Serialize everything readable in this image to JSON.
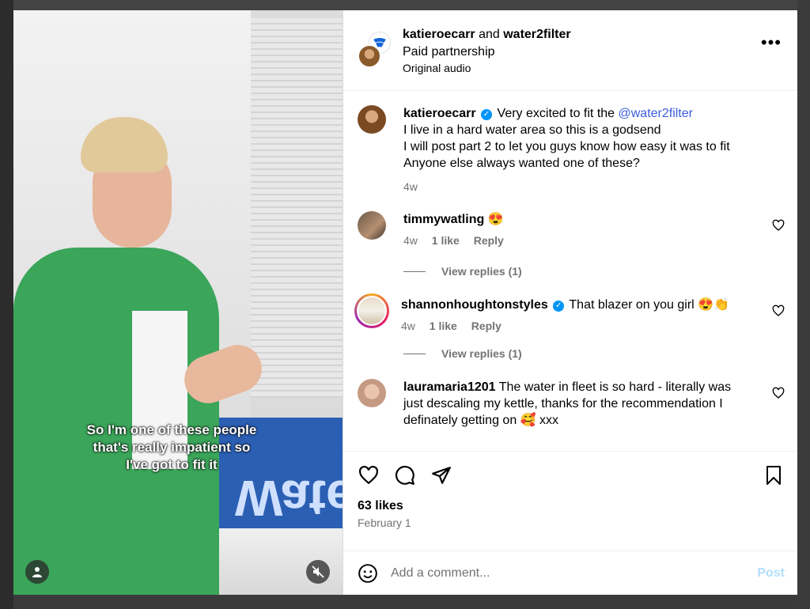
{
  "header": {
    "author": "katieroecarr",
    "conjunction": "and",
    "collaborator": "water2filter",
    "subtitle": "Paid partnership",
    "audio": "Original audio",
    "more_label": "•••"
  },
  "media": {
    "caption_lines": [
      "So I'm one of these people",
      "that's really impatient so",
      "I've got to fit it"
    ],
    "box_text": "Water"
  },
  "comments": [
    {
      "user": "katieroecarr",
      "verified": true,
      "text_before": "Very excited to fit the ",
      "mention": "@water2filter",
      "lines": [
        "I live in a hard water area so this is a godsend",
        "I will post part 2 to let you guys know how easy it was to fit",
        "Anyone else always wanted one of these?"
      ],
      "time": "4w"
    },
    {
      "user": "timmywatling",
      "text": "😍",
      "time": "4w",
      "likes": "1 like",
      "reply": "Reply",
      "view_replies": "View replies (1)"
    },
    {
      "user": "shannonhoughtonstyles",
      "verified": true,
      "text": "That blazer on you girl 😍👏",
      "time": "4w",
      "likes": "1 like",
      "reply": "Reply",
      "view_replies": "View replies (1)"
    },
    {
      "user": "lauramaria1201",
      "text": "The water in fleet is so hard - literally was just descaling my kettle, thanks for the recommendation I definately getting on 🥰 xxx"
    }
  ],
  "footer": {
    "likes": "63 likes",
    "date": "February 1",
    "comment_placeholder": "Add a comment...",
    "post_label": "Post"
  },
  "colors": {
    "link": "#3b5bdb",
    "verified": "#0095f6",
    "post_disabled": "#b2dffc"
  }
}
